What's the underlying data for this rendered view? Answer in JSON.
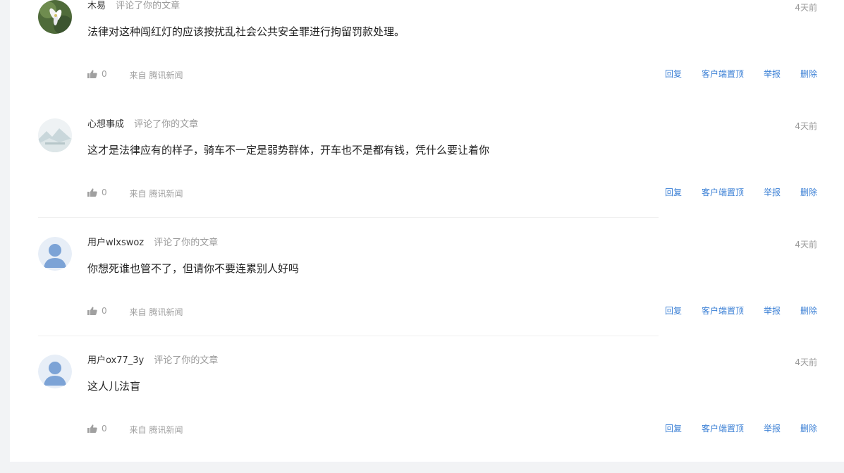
{
  "comments": [
    {
      "username": "木易",
      "action": "评论了你的文章",
      "time": "4天前",
      "content": "法律对这种闯红灯的应该按扰乱社会公共安全罪进行拘留罚款处理。",
      "likes": "0",
      "source_prefix": "来自",
      "source": "腾讯新闻",
      "avatar": "flower-photo"
    },
    {
      "username": "心想事成",
      "action": "评论了你的文章",
      "time": "4天前",
      "content": "这才是法律应有的样子，骑车不一定是弱势群体，开车也不是都有钱，凭什么要让着你",
      "likes": "0",
      "source_prefix": "来自",
      "source": "腾讯新闻",
      "avatar": "landscape-photo"
    },
    {
      "username": "用户wlxswoz",
      "action": "评论了你的文章",
      "time": "4天前",
      "content": "你想死谁也管不了，但请你不要连累别人好吗",
      "likes": "0",
      "source_prefix": "来自",
      "source": "腾讯新闻",
      "avatar": "default-user"
    },
    {
      "username": "用户ox77_3y",
      "action": "评论了你的文章",
      "time": "4天前",
      "content": "这人儿法盲",
      "likes": "0",
      "source_prefix": "来自",
      "source": "腾讯新闻",
      "avatar": "default-user"
    }
  ],
  "actions": {
    "reply": "回复",
    "pin": "客户端置顶",
    "report": "举报",
    "delete": "删除"
  },
  "colors": {
    "link": "#3a7fd5",
    "muted": "#9a9a9a",
    "text": "#222222",
    "default_avatar": "#7ca3d6"
  }
}
